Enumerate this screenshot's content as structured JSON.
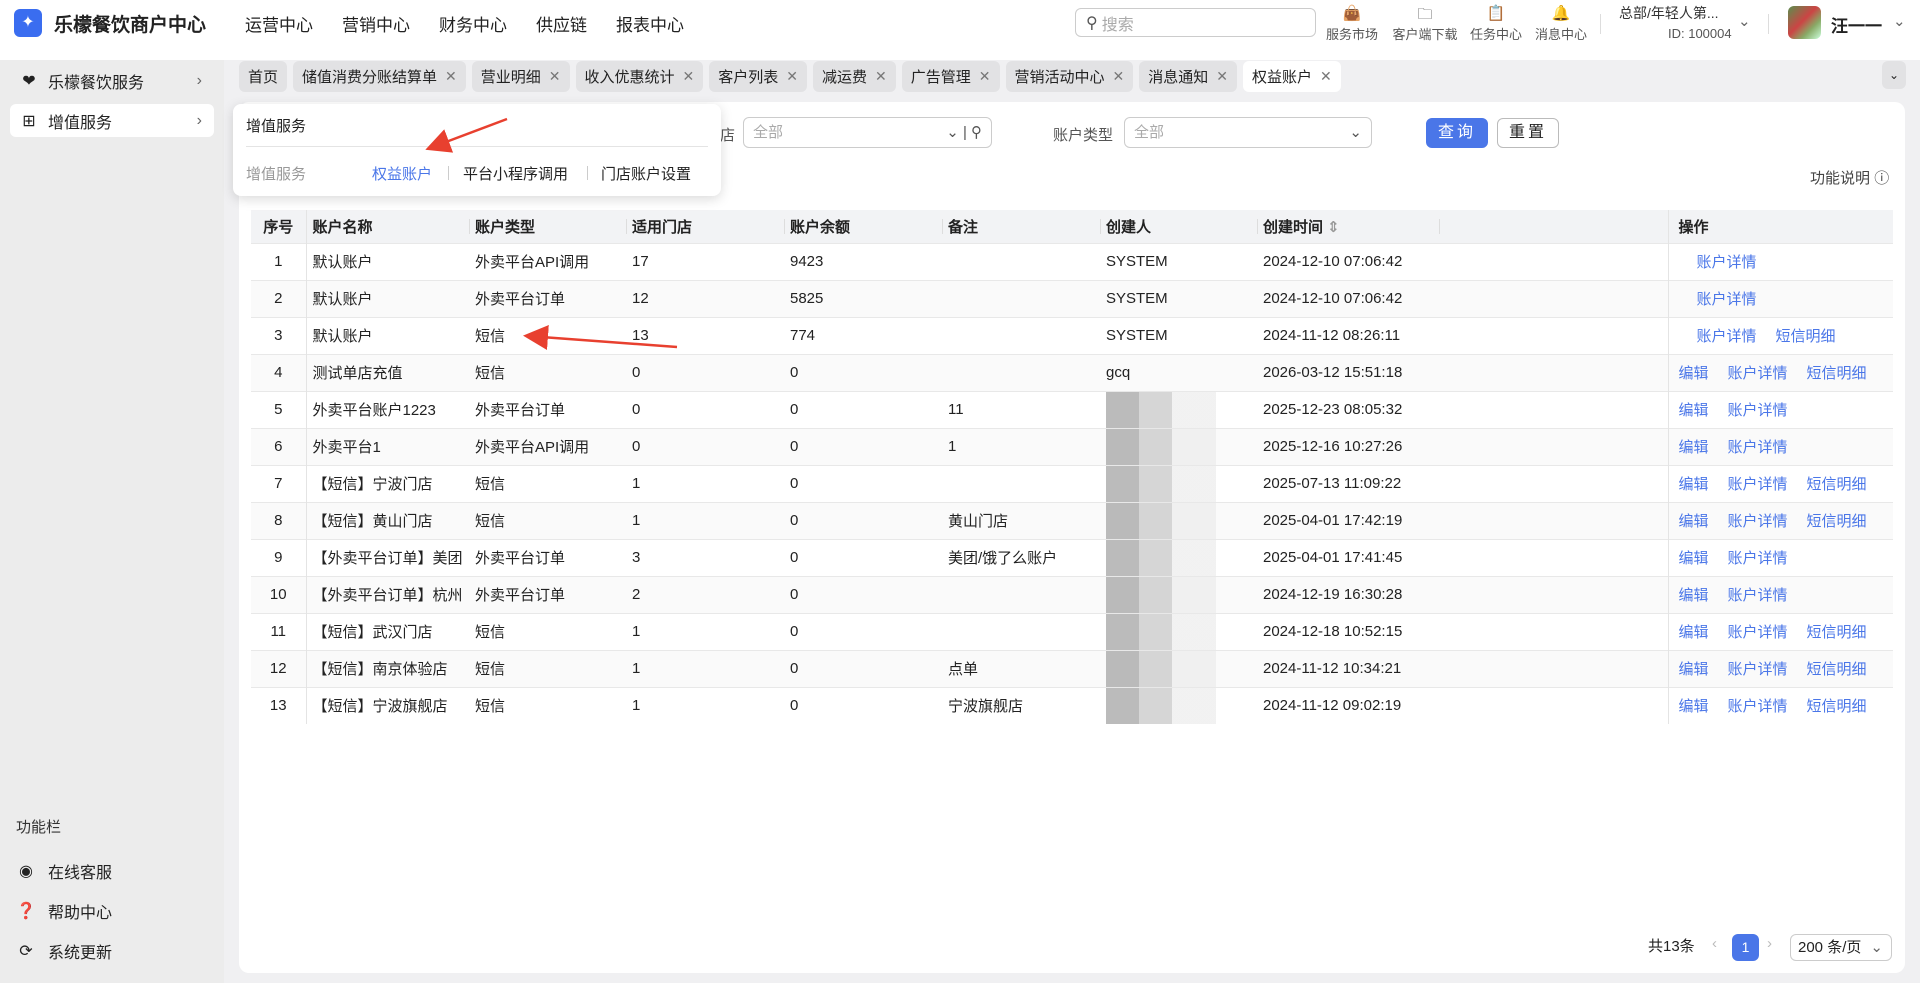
{
  "app": {
    "title": "乐檬餐饮商户中心",
    "logo_icon": "flame-logo-icon"
  },
  "topnav": [
    "运营中心",
    "营销中心",
    "财务中心",
    "供应链",
    "报表中心"
  ],
  "search": {
    "placeholder": "搜索"
  },
  "tools": [
    {
      "label": "服务市场",
      "icon": "bag-icon"
    },
    {
      "label": "客户端下载",
      "icon": "folder-download-icon"
    },
    {
      "label": "任务中心",
      "icon": "clipboard-check-icon"
    },
    {
      "label": "消息中心",
      "icon": "bell-icon"
    }
  ],
  "org": {
    "name": "总部/年轻人第...",
    "id": "ID: 100004"
  },
  "user": {
    "name": "汪一一"
  },
  "sidebar": {
    "items": [
      {
        "label": "乐檬餐饮服务"
      },
      {
        "label": "增值服务"
      }
    ],
    "footer_title": "功能栏",
    "footer": [
      {
        "label": "在线客服"
      },
      {
        "label": "帮助中心"
      },
      {
        "label": "系统更新"
      }
    ]
  },
  "tabs": [
    {
      "label": "首页",
      "closable": false
    },
    {
      "label": "储值消费分账结算单",
      "closable": true
    },
    {
      "label": "营业明细",
      "closable": true
    },
    {
      "label": "收入优惠统计",
      "closable": true
    },
    {
      "label": "客户列表",
      "closable": true
    },
    {
      "label": "减运费",
      "closable": true
    },
    {
      "label": "广告管理",
      "closable": true
    },
    {
      "label": "营销活动中心",
      "closable": true
    },
    {
      "label": "消息通知",
      "closable": true
    },
    {
      "label": "权益账户",
      "closable": true,
      "active": true
    }
  ],
  "popup": {
    "title": "增值服务",
    "category": "增值服务",
    "links": [
      "权益账户",
      "平台小程序调用",
      "门店账户设置"
    ],
    "active": "权益账户"
  },
  "filters": {
    "store_label": "店",
    "store_value": "全部",
    "type_label": "账户类型",
    "type_value": "全部",
    "query": "查询",
    "reset": "重置"
  },
  "help": "功能说明",
  "table": {
    "columns": [
      "序号",
      "账户名称",
      "账户类型",
      "适用门店",
      "账户余额",
      "备注",
      "创建人",
      "创建时间",
      "",
      "操作"
    ],
    "rows": [
      {
        "seq": "1",
        "name": "默认账户",
        "type": "外卖平台API调用",
        "stores": "17",
        "balance": "9423",
        "note": "",
        "creator": "SYSTEM",
        "time": "2024-12-10 07:06:42",
        "ops": [
          "账户详情"
        ]
      },
      {
        "seq": "2",
        "name": "默认账户",
        "type": "外卖平台订单",
        "stores": "12",
        "balance": "5825",
        "note": "",
        "creator": "SYSTEM",
        "time": "2024-12-10 07:06:42",
        "ops": [
          "账户详情"
        ]
      },
      {
        "seq": "3",
        "name": "默认账户",
        "type": "短信",
        "stores": "13",
        "balance": "774",
        "note": "",
        "creator": "SYSTEM",
        "time": "2024-11-12 08:26:11",
        "ops": [
          "账户详情",
          "短信明细"
        ]
      },
      {
        "seq": "4",
        "name": "测试单店充值",
        "type": "短信",
        "stores": "0",
        "balance": "0",
        "note": "",
        "creator": "gcq",
        "time": "2026-03-12 15:51:18",
        "ops": [
          "编辑",
          "账户详情",
          "短信明细"
        ]
      },
      {
        "seq": "5",
        "name": "外卖平台账户1223",
        "type": "外卖平台订单",
        "stores": "0",
        "balance": "0",
        "note": "11",
        "creator": null,
        "time": "2025-12-23 08:05:32",
        "ops": [
          "编辑",
          "账户详情"
        ]
      },
      {
        "seq": "6",
        "name": "外卖平台1",
        "type": "外卖平台API调用",
        "stores": "0",
        "balance": "0",
        "note": "1",
        "creator": null,
        "time": "2025-12-16 10:27:26",
        "ops": [
          "编辑",
          "账户详情"
        ]
      },
      {
        "seq": "7",
        "name": "【短信】宁波门店",
        "type": "短信",
        "stores": "1",
        "balance": "0",
        "note": "",
        "creator": null,
        "time": "2025-07-13 11:09:22",
        "ops": [
          "编辑",
          "账户详情",
          "短信明细"
        ]
      },
      {
        "seq": "8",
        "name": "【短信】黄山门店",
        "type": "短信",
        "stores": "1",
        "balance": "0",
        "note": "黄山门店",
        "creator": null,
        "time": "2025-04-01 17:42:19",
        "ops": [
          "编辑",
          "账户详情",
          "短信明细"
        ]
      },
      {
        "seq": "9",
        "name": "【外卖平台订单】美团",
        "type": "外卖平台订单",
        "stores": "3",
        "balance": "0",
        "note": "美团/饿了么账户",
        "creator": null,
        "time": "2025-04-01 17:41:45",
        "ops": [
          "编辑",
          "账户详情"
        ]
      },
      {
        "seq": "10",
        "name": "【外卖平台订单】杭州",
        "type": "外卖平台订单",
        "stores": "2",
        "balance": "0",
        "note": "",
        "creator": null,
        "time": "2024-12-19 16:30:28",
        "ops": [
          "编辑",
          "账户详情"
        ]
      },
      {
        "seq": "11",
        "name": "【短信】武汉门店",
        "type": "短信",
        "stores": "1",
        "balance": "0",
        "note": "",
        "creator": null,
        "time": "2024-12-18 10:52:15",
        "ops": [
          "编辑",
          "账户详情",
          "短信明细"
        ]
      },
      {
        "seq": "12",
        "name": "【短信】南京体验店",
        "type": "短信",
        "stores": "1",
        "balance": "0",
        "note": "点单",
        "creator": null,
        "time": "2024-11-12 10:34:21",
        "ops": [
          "编辑",
          "账户详情",
          "短信明细"
        ]
      },
      {
        "seq": "13",
        "name": "【短信】宁波旗舰店",
        "type": "短信",
        "stores": "1",
        "balance": "0",
        "note": "宁波旗舰店",
        "creator": null,
        "time": "2024-11-12 09:02:19",
        "ops": [
          "编辑",
          "账户详情",
          "短信明细"
        ]
      }
    ]
  },
  "pagination": {
    "total": "共13条",
    "page": "1",
    "page_size": "200 条/页"
  },
  "colors": {
    "accent": "#4a76e8",
    "annotation_arrow": "#e8402f"
  }
}
